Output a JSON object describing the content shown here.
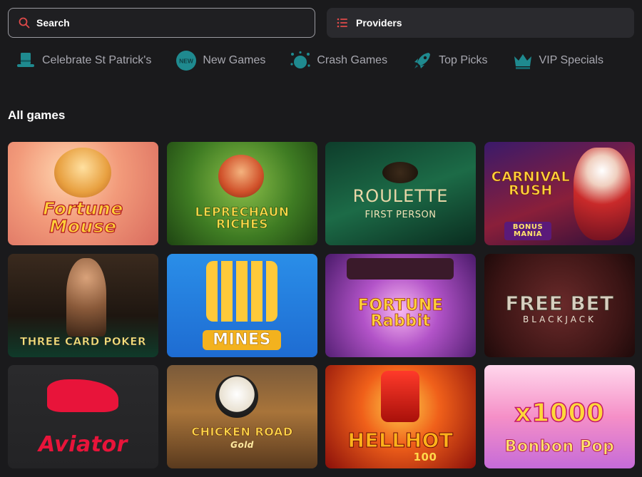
{
  "search": {
    "label": "Search"
  },
  "providers": {
    "label": "Providers"
  },
  "categories": [
    {
      "label": "Celebrate St Patrick's",
      "icon": "leprechaun-hat-icon"
    },
    {
      "label": "New Games",
      "icon": "new-badge-icon"
    },
    {
      "label": "Crash Games",
      "icon": "crash-bomb-icon"
    },
    {
      "label": "Top Picks",
      "icon": "rocket-icon"
    },
    {
      "label": "VIP Specials",
      "icon": "crown-icon"
    }
  ],
  "section": {
    "title": "All games"
  },
  "games": [
    {
      "title": "Fortune Mouse"
    },
    {
      "title": "LEPRECHAUN RICHES"
    },
    {
      "title": "ROULETTE",
      "subtitle": "FIRST PERSON"
    },
    {
      "title": "CARNIVAL RUSH",
      "badge": "BONUS MANIA"
    },
    {
      "title": "THREE CARD POKER"
    },
    {
      "title": "MINES"
    },
    {
      "title": "FORTUNE Rabbit"
    },
    {
      "title": "FREE BET",
      "subtitle": "BLACKJACK"
    },
    {
      "title": "Aviator"
    },
    {
      "title": "CHICKEN ROAD",
      "subtitle": "Gold"
    },
    {
      "title": "HELLHOT",
      "subtitle": "100"
    },
    {
      "title": "x1000",
      "subtitle": "Bonbon Pop"
    }
  ],
  "colors": {
    "accent_red": "#e04a4a",
    "accent_teal": "#1f8a8f"
  }
}
